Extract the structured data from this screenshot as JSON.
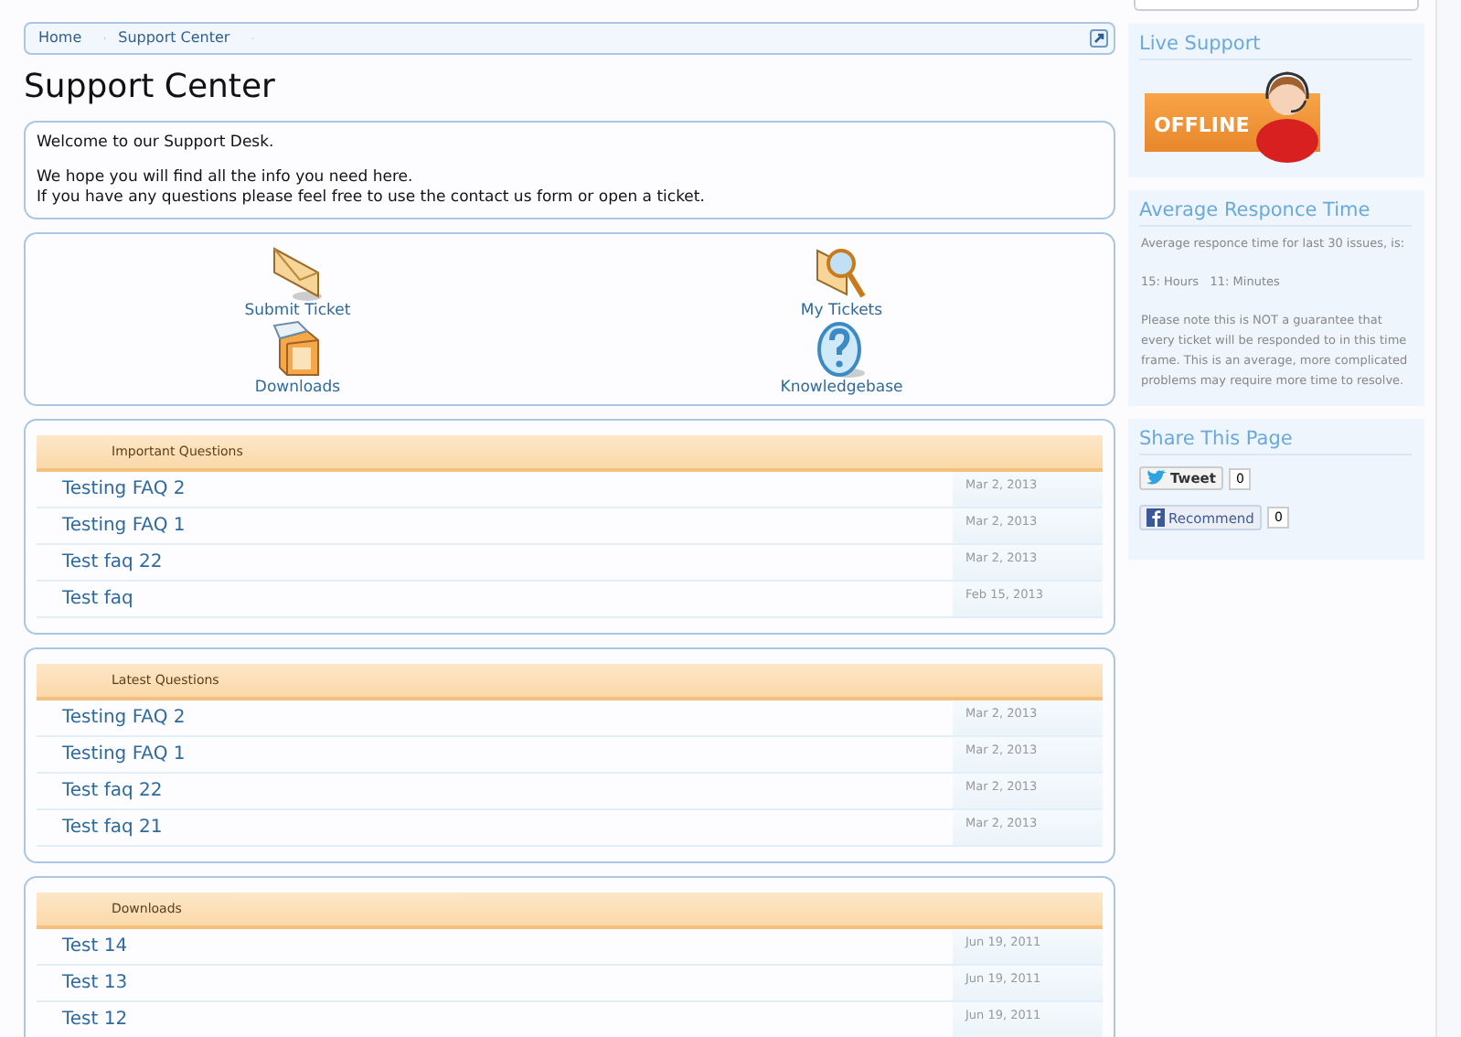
{
  "breadcrumb": [
    {
      "label": "Home"
    },
    {
      "label": "Support Center"
    }
  ],
  "title": "Support Center",
  "welcome": [
    "Welcome to our Support Desk.",
    "We hope you will find all the info you need here.",
    "If you have any questions please feel free to use the contact us form or open a ticket."
  ],
  "shortcuts": [
    {
      "label": "Submit Ticket",
      "kind": "envelope"
    },
    {
      "label": "My Tickets",
      "kind": "search"
    },
    {
      "label": "Downloads",
      "kind": "box"
    },
    {
      "label": "Knowledgebase",
      "kind": "help"
    }
  ],
  "sections": [
    {
      "heading": "Important Questions",
      "rows": [
        {
          "title": "Testing FAQ 2",
          "date": "Mar 2, 2013"
        },
        {
          "title": "Testing FAQ 1",
          "date": "Mar 2, 2013"
        },
        {
          "title": "Test faq 22",
          "date": "Mar 2, 2013"
        },
        {
          "title": "Test faq",
          "date": "Feb 15, 2013"
        }
      ]
    },
    {
      "heading": "Latest Questions",
      "rows": [
        {
          "title": "Testing FAQ 2",
          "date": "Mar 2, 2013"
        },
        {
          "title": "Testing FAQ 1",
          "date": "Mar 2, 2013"
        },
        {
          "title": "Test faq 22",
          "date": "Mar 2, 2013"
        },
        {
          "title": "Test faq 21",
          "date": "Mar 2, 2013"
        }
      ]
    },
    {
      "heading": "Downloads",
      "rows": [
        {
          "title": "Test 14",
          "date": "Jun 19, 2011"
        },
        {
          "title": "Test 13",
          "date": "Jun 19, 2011"
        },
        {
          "title": "Test 12",
          "date": "Jun 19, 2011"
        }
      ]
    }
  ],
  "sidebar": {
    "live_support": {
      "heading": "Live Support",
      "status": "OFFLINE"
    },
    "response_time": {
      "heading": "Average Responce Time",
      "intro": "Average responce time for last 30 issues, is:",
      "hours": "15: Hours",
      "minutes": "11: Minutes",
      "note": "Please note this is NOT a guarantee that every ticket will be responded to in this time frame. This is an average, more complicated problems may require more time to resolve."
    },
    "share": {
      "heading": "Share This Page",
      "tweet": "Tweet",
      "tweet_count": "0",
      "recommend": "Recommend",
      "recommend_count": "0"
    }
  }
}
